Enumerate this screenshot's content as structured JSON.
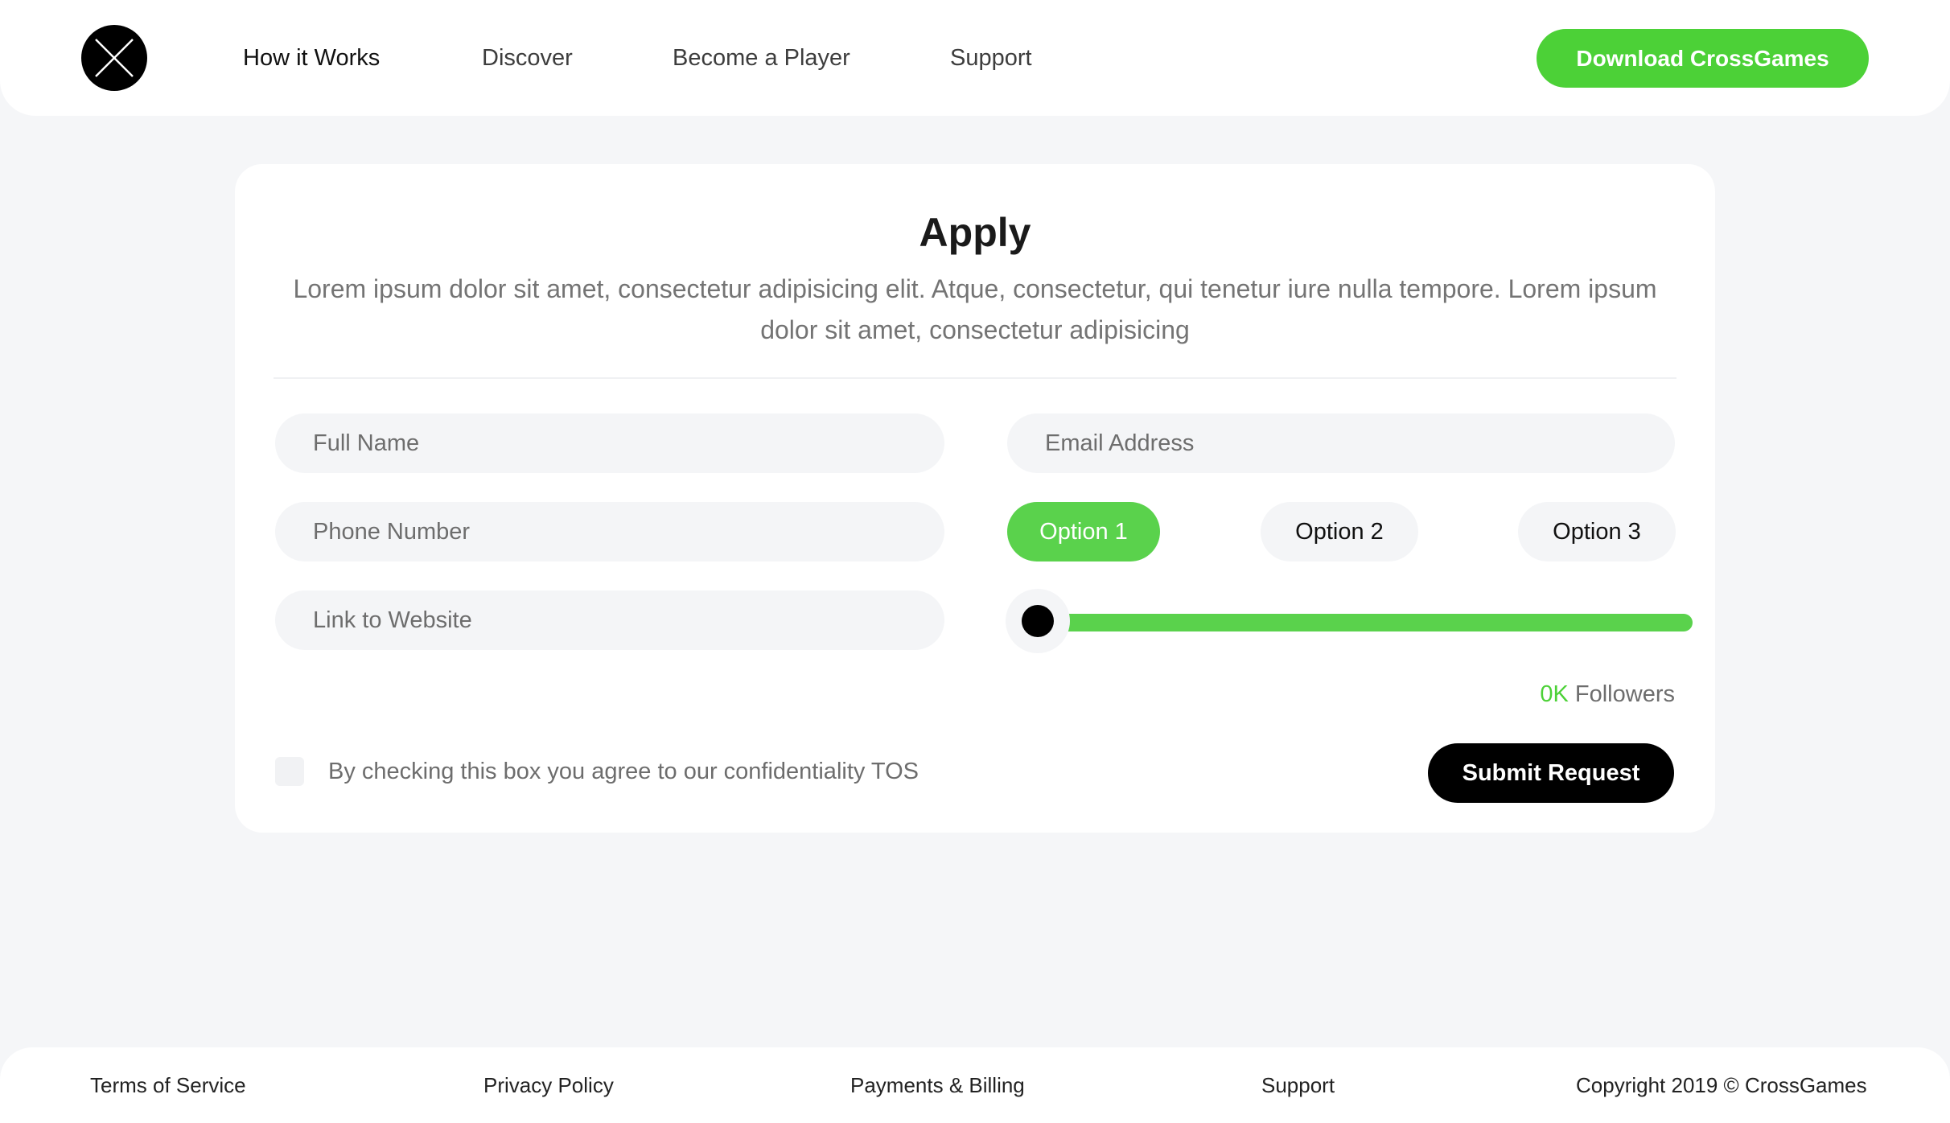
{
  "header": {
    "logo_icon": "x-circle-logo-icon",
    "nav": [
      {
        "label": "How it Works"
      },
      {
        "label": "Discover"
      },
      {
        "label": "Become a Player"
      },
      {
        "label": "Support"
      }
    ],
    "download_label": "Download CrossGames"
  },
  "form": {
    "title": "Apply",
    "description": "Lorem ipsum dolor sit amet, consectetur adipisicing elit. Atque, consectetur, qui tenetur iure nulla tempore. Lorem ipsum dolor sit amet, consectetur adipisicing",
    "fields": {
      "full_name": {
        "placeholder": "Full Name",
        "value": ""
      },
      "email": {
        "placeholder": "Email Address",
        "value": ""
      },
      "phone": {
        "placeholder": "Phone Number",
        "value": ""
      },
      "website": {
        "placeholder": "Link to Website",
        "value": ""
      }
    },
    "options": [
      {
        "label": "Option 1",
        "selected": true
      },
      {
        "label": "Option 2",
        "selected": false
      },
      {
        "label": "Option 3",
        "selected": false
      }
    ],
    "followers": {
      "count": "0K",
      "label": " Followers",
      "slider_value": 0
    },
    "tos_checked": false,
    "tos_label": "By checking this box you agree to our confidentiality TOS",
    "submit_label": "Submit Request"
  },
  "footer": {
    "links": [
      {
        "label": "Terms of Service"
      },
      {
        "label": "Privacy Policy"
      },
      {
        "label": "Payments & Billing"
      },
      {
        "label": "Support"
      }
    ],
    "copyright": "Copyright 2019 © CrossGames"
  },
  "colors": {
    "accent": "#4cd137",
    "background": "#f5f6f8",
    "primary_dark": "#000000"
  }
}
